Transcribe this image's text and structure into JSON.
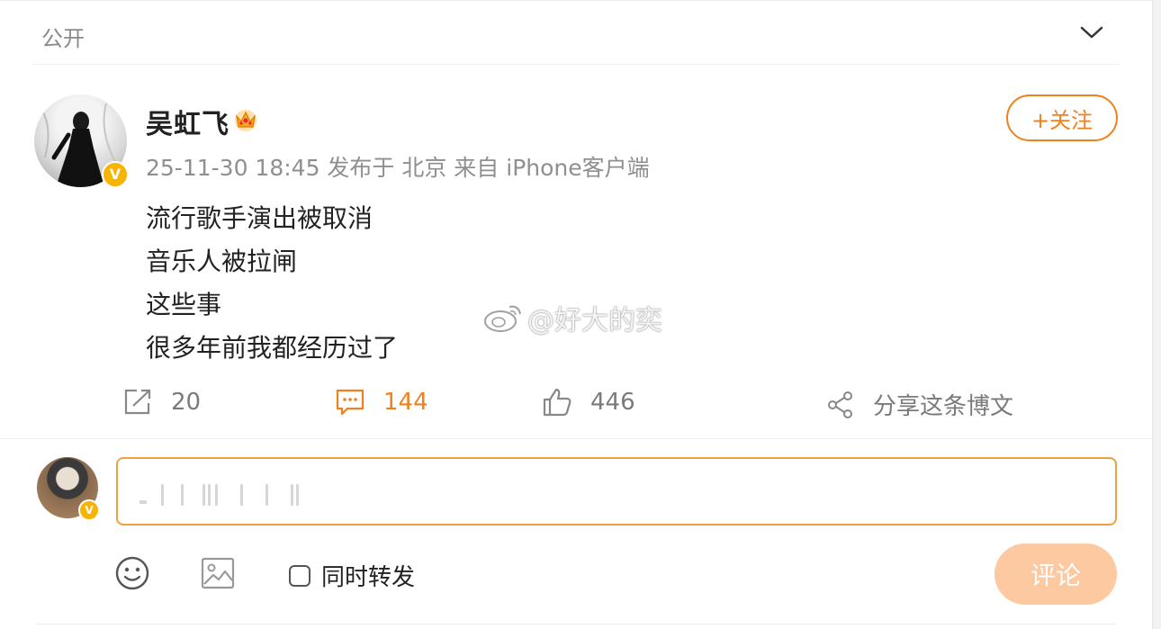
{
  "visibility": {
    "label": "公开"
  },
  "post": {
    "author": "吴虹飞",
    "meta": "25-11-30 18:45 发布于 北京 来自 iPhone客户端",
    "follow_label": "+关注",
    "lines": [
      "流行歌手演出被取消",
      "音乐人被拉闸",
      "这些事",
      "很多年前我都经历过了"
    ],
    "watermark": "@好大的奕"
  },
  "actions": {
    "repost_count": "20",
    "comment_count": "144",
    "like_count": "446",
    "share_label": "分享这条博文"
  },
  "composer": {
    "forward_label": "同时转发",
    "submit_label": "评论"
  },
  "colors": {
    "accent": "#f0801d",
    "verified": "#f8b400",
    "submit_disabled": "#fcc9a1"
  },
  "icons": [
    "chevron-down-icon",
    "crown-icon",
    "verified-icon",
    "repost-icon",
    "comment-icon",
    "like-icon",
    "share-icon",
    "emoji-icon",
    "image-icon",
    "weibo-logo-icon"
  ]
}
